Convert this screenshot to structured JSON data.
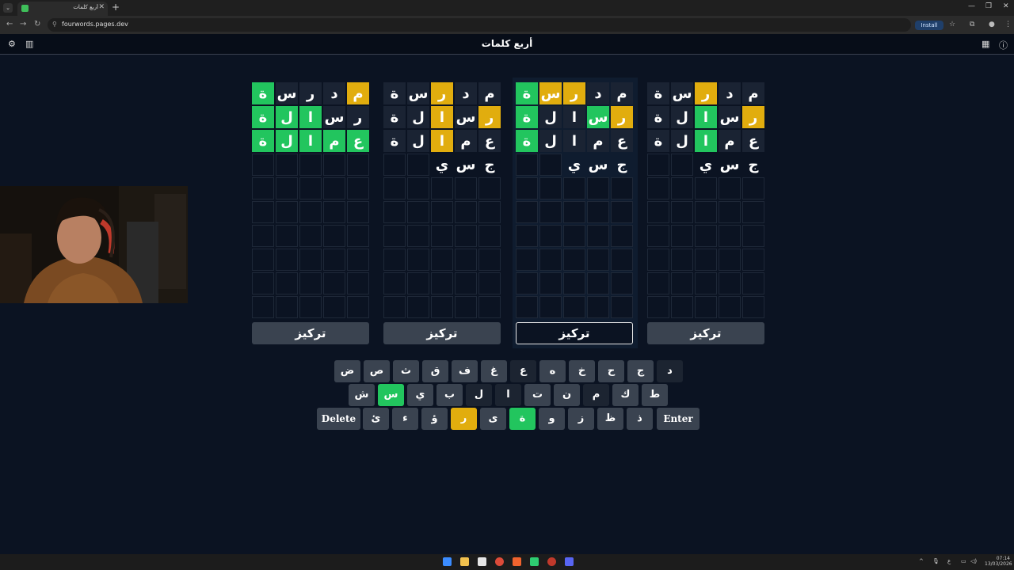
{
  "browser": {
    "tab_title": "أربع كلمات",
    "url": "fourwords.pages.dev",
    "install_label": "Install",
    "new_tab_label": "+",
    "tab_close": "✕",
    "tab_menu": "⌄",
    "minimize": "—",
    "restore": "❐",
    "close": "✕"
  },
  "app": {
    "title": "أربع كلمات",
    "focus_label": "تركيز",
    "boards": [
      {
        "rows": [
          [
            {
              "l": "م",
              "s": "y"
            },
            {
              "l": "د",
              "s": "f"
            },
            {
              "l": "ر",
              "s": "f"
            },
            {
              "l": "س",
              "s": "f"
            },
            {
              "l": "ة",
              "s": "g"
            }
          ],
          [
            {
              "l": "ر",
              "s": "f"
            },
            {
              "l": "س",
              "s": "f"
            },
            {
              "l": "ا",
              "s": "g"
            },
            {
              "l": "ل",
              "s": "g"
            },
            {
              "l": "ة",
              "s": "g"
            }
          ],
          [
            {
              "l": "ع",
              "s": "g"
            },
            {
              "l": "م",
              "s": "g"
            },
            {
              "l": "ا",
              "s": "g"
            },
            {
              "l": "ل",
              "s": "g"
            },
            {
              "l": "ة",
              "s": "g"
            }
          ]
        ],
        "current": [
          "",
          "",
          "",
          "",
          ""
        ]
      },
      {
        "rows": [
          [
            {
              "l": "م",
              "s": "f"
            },
            {
              "l": "د",
              "s": "f"
            },
            {
              "l": "ر",
              "s": "y"
            },
            {
              "l": "س",
              "s": "f"
            },
            {
              "l": "ة",
              "s": "f"
            }
          ],
          [
            {
              "l": "ر",
              "s": "y"
            },
            {
              "l": "س",
              "s": "f"
            },
            {
              "l": "ا",
              "s": "y"
            },
            {
              "l": "ل",
              "s": "f"
            },
            {
              "l": "ة",
              "s": "f"
            }
          ],
          [
            {
              "l": "ع",
              "s": "f"
            },
            {
              "l": "م",
              "s": "f"
            },
            {
              "l": "ا",
              "s": "y"
            },
            {
              "l": "ل",
              "s": "f"
            },
            {
              "l": "ة",
              "s": "f"
            }
          ]
        ],
        "current": [
          "ج",
          "س",
          "ي",
          "",
          ""
        ]
      },
      {
        "rows": [
          [
            {
              "l": "م",
              "s": "f"
            },
            {
              "l": "د",
              "s": "f"
            },
            {
              "l": "ر",
              "s": "y"
            },
            {
              "l": "س",
              "s": "y"
            },
            {
              "l": "ة",
              "s": "g"
            }
          ],
          [
            {
              "l": "ر",
              "s": "y"
            },
            {
              "l": "س",
              "s": "g"
            },
            {
              "l": "ا",
              "s": "f"
            },
            {
              "l": "ل",
              "s": "f"
            },
            {
              "l": "ة",
              "s": "g"
            }
          ],
          [
            {
              "l": "ع",
              "s": "f"
            },
            {
              "l": "م",
              "s": "f"
            },
            {
              "l": "ا",
              "s": "f"
            },
            {
              "l": "ل",
              "s": "f"
            },
            {
              "l": "ة",
              "s": "g"
            }
          ]
        ],
        "current": [
          "ج",
          "س",
          "ي",
          "",
          ""
        ]
      },
      {
        "rows": [
          [
            {
              "l": "م",
              "s": "f"
            },
            {
              "l": "د",
              "s": "f"
            },
            {
              "l": "ر",
              "s": "y"
            },
            {
              "l": "س",
              "s": "f"
            },
            {
              "l": "ة",
              "s": "f"
            }
          ],
          [
            {
              "l": "ر",
              "s": "y"
            },
            {
              "l": "س",
              "s": "f"
            },
            {
              "l": "ا",
              "s": "g"
            },
            {
              "l": "ل",
              "s": "f"
            },
            {
              "l": "ة",
              "s": "f"
            }
          ],
          [
            {
              "l": "ع",
              "s": "f"
            },
            {
              "l": "م",
              "s": "f"
            },
            {
              "l": "ا",
              "s": "g"
            },
            {
              "l": "ل",
              "s": "f"
            },
            {
              "l": "ة",
              "s": "f"
            }
          ]
        ],
        "current": [
          "ج",
          "س",
          "ي",
          "",
          ""
        ]
      }
    ],
    "active_board": 2,
    "keyboard": {
      "row1": [
        {
          "k": "د",
          "s": "d"
        },
        {
          "k": "ج",
          "s": ""
        },
        {
          "k": "ح",
          "s": ""
        },
        {
          "k": "خ",
          "s": ""
        },
        {
          "k": "ه",
          "s": ""
        },
        {
          "k": "ع",
          "s": "d"
        },
        {
          "k": "غ",
          "s": ""
        },
        {
          "k": "ف",
          "s": ""
        },
        {
          "k": "ق",
          "s": ""
        },
        {
          "k": "ث",
          "s": ""
        },
        {
          "k": "ص",
          "s": ""
        },
        {
          "k": "ض",
          "s": ""
        }
      ],
      "row2": [
        {
          "k": "ط",
          "s": ""
        },
        {
          "k": "ك",
          "s": ""
        },
        {
          "k": "م",
          "s": "d"
        },
        {
          "k": "ن",
          "s": ""
        },
        {
          "k": "ت",
          "s": ""
        },
        {
          "k": "ا",
          "s": "d"
        },
        {
          "k": "ل",
          "s": "d"
        },
        {
          "k": "ب",
          "s": ""
        },
        {
          "k": "ي",
          "s": ""
        },
        {
          "k": "س",
          "s": "g"
        },
        {
          "k": "ش",
          "s": ""
        }
      ],
      "row3": [
        {
          "k": "ذ",
          "s": ""
        },
        {
          "k": "ظ",
          "s": ""
        },
        {
          "k": "ز",
          "s": ""
        },
        {
          "k": "و",
          "s": ""
        },
        {
          "k": "ة",
          "s": "g"
        },
        {
          "k": "ى",
          "s": ""
        },
        {
          "k": "ر",
          "s": "y"
        },
        {
          "k": "ؤ",
          "s": ""
        },
        {
          "k": "ء",
          "s": ""
        },
        {
          "k": "ئ",
          "s": ""
        }
      ],
      "enter_label": "Enter",
      "delete_label": "Delete"
    }
  },
  "colors": {
    "green": "#22c55e",
    "yellow": "#e1ad0e",
    "key": "#3a4350",
    "background": "#0b1322"
  },
  "taskbar": {
    "time": "07:14",
    "date": "13/03/2026",
    "lang": "ع"
  }
}
